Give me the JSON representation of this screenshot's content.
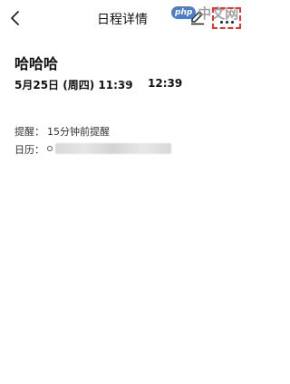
{
  "header": {
    "title": "日程详情"
  },
  "watermark": {
    "badge": "php",
    "text": "中文网"
  },
  "event": {
    "title": "哈哈哈",
    "start": "5月25日 (周四) 11:39",
    "arrow": "→",
    "end": "12:39"
  },
  "details": {
    "reminder_label": "提醒：",
    "reminder_value": "15分钟前提醒",
    "calendar_label": "日历："
  },
  "colors": {
    "highlight_box": "#e03a2f"
  },
  "icons": [
    "back-arrow-icon",
    "edit-pencil-icon",
    "more-dots-icon"
  ]
}
